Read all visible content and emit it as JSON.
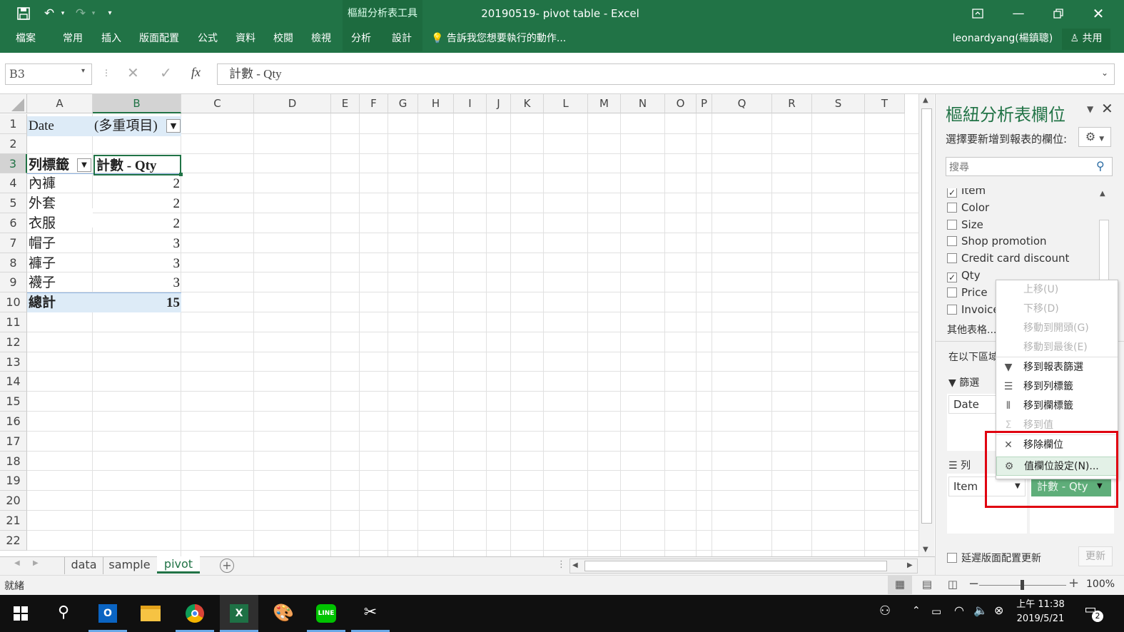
{
  "window": {
    "title": "20190519- pivot table - Excel",
    "context_tab_group": "樞紐分析表工具",
    "user": "leonardyang(楊鎮聰)",
    "share": "共用"
  },
  "ribbon": {
    "tabs": [
      "檔案",
      "常用",
      "插入",
      "版面配置",
      "公式",
      "資料",
      "校閱",
      "檢視",
      "分析",
      "設計"
    ],
    "tell_me": "告訴我您想要執行的動作..."
  },
  "formula_bar": {
    "name_box": "B3",
    "fx": "fx",
    "formula": "計數 - Qty"
  },
  "grid": {
    "columns": [
      "A",
      "B",
      "C",
      "D",
      "E",
      "F",
      "G",
      "H",
      "I",
      "J",
      "K",
      "L",
      "M",
      "N",
      "O",
      "P",
      "Q",
      "R",
      "S",
      "T"
    ],
    "rows": [
      "1",
      "2",
      "3",
      "4",
      "5",
      "6",
      "7",
      "8",
      "9",
      "10",
      "11",
      "12",
      "13",
      "14",
      "15",
      "16",
      "17",
      "18",
      "19",
      "20",
      "21",
      "22"
    ],
    "filter": {
      "label": "Date",
      "value": "(多重項目)"
    },
    "header": {
      "row_label": "列標籤",
      "value_label": "計數 - Qty"
    },
    "items": [
      {
        "label": "內褲",
        "value": "2"
      },
      {
        "label": "外套",
        "value": "2"
      },
      {
        "label": "衣服",
        "value": "2"
      },
      {
        "label": "帽子",
        "value": "3"
      },
      {
        "label": "褲子",
        "value": "3"
      },
      {
        "label": "襪子",
        "value": "3"
      }
    ],
    "total": {
      "label": "總計",
      "value": "15"
    }
  },
  "sheets": {
    "tabs": [
      "data",
      "sample",
      "pivot"
    ],
    "active": "pivot"
  },
  "status": {
    "ready": "就緒",
    "zoom": "100%"
  },
  "pane": {
    "title": "樞紐分析表欄位",
    "choose_label": "選擇要新增到報表的欄位:",
    "search_placeholder": "搜尋",
    "fields": [
      {
        "name": "Item",
        "checked": true
      },
      {
        "name": "Color",
        "checked": false
      },
      {
        "name": "Size",
        "checked": false
      },
      {
        "name": "Shop promotion",
        "checked": false
      },
      {
        "name": "Credit card discount",
        "checked": false
      },
      {
        "name": "Qty",
        "checked": true
      },
      {
        "name": "Price",
        "checked": false
      },
      {
        "name": "Invoice",
        "checked": false
      }
    ],
    "more_tables": "其他表格...",
    "areas_label": "在以下區域",
    "filters_label": "篩選",
    "filters_item": "Date",
    "rows_label": "列",
    "rows_item": "Item",
    "values_item": "計數 - Qty",
    "defer_label": "延遲版面配置更新",
    "update_button": "更新"
  },
  "context_menu": {
    "items": [
      {
        "label": "上移(U)",
        "disabled": true,
        "icon": ""
      },
      {
        "label": "下移(D)",
        "disabled": true,
        "icon": ""
      },
      {
        "label": "移動到開頭(G)",
        "disabled": true,
        "icon": ""
      },
      {
        "label": "移動到最後(E)",
        "disabled": true,
        "icon": ""
      },
      {
        "label": "移到報表篩選",
        "disabled": false,
        "icon": "filter-icon"
      },
      {
        "label": "移到列標籤",
        "disabled": false,
        "icon": "rows-icon"
      },
      {
        "label": "移到欄標籤",
        "disabled": false,
        "icon": "columns-icon"
      },
      {
        "label": "移到值",
        "disabled": true,
        "icon": "sigma-icon"
      },
      {
        "label": "移除欄位",
        "disabled": false,
        "icon": "remove-icon"
      },
      {
        "label": "值欄位設定(N)...",
        "disabled": false,
        "icon": "field-settings-icon"
      }
    ]
  },
  "taskbar": {
    "time": "上午 11:38",
    "date": "2019/5/21",
    "notifications": "2"
  },
  "colors": {
    "excel_green": "#217346",
    "highlight_red": "#e00010",
    "values_green": "#5fae7a"
  }
}
